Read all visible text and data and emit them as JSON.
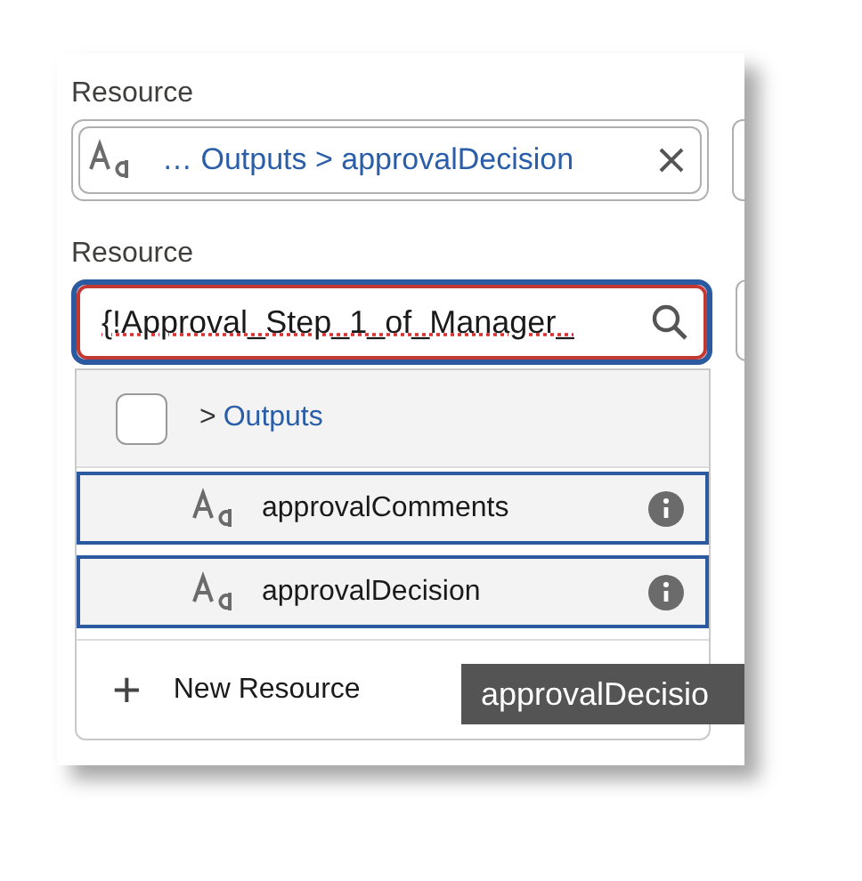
{
  "rows": [
    {
      "label": "Resource",
      "kind": "chip",
      "value": "… Outputs > approvalDecision"
    },
    {
      "label": "Resource",
      "kind": "search",
      "value": "{!Approval_Step_1_of_Manager_",
      "focused": true
    }
  ],
  "dropdown": {
    "header": {
      "checked": false,
      "separator": ">",
      "path": "Outputs"
    },
    "items": [
      {
        "label": "approvalComments",
        "focused": true
      },
      {
        "label": "approvalDecision",
        "focused": true
      }
    ],
    "new_resource": {
      "symbol": "+",
      "label": "New Resource"
    }
  },
  "tooltip": "approvalDecisio"
}
